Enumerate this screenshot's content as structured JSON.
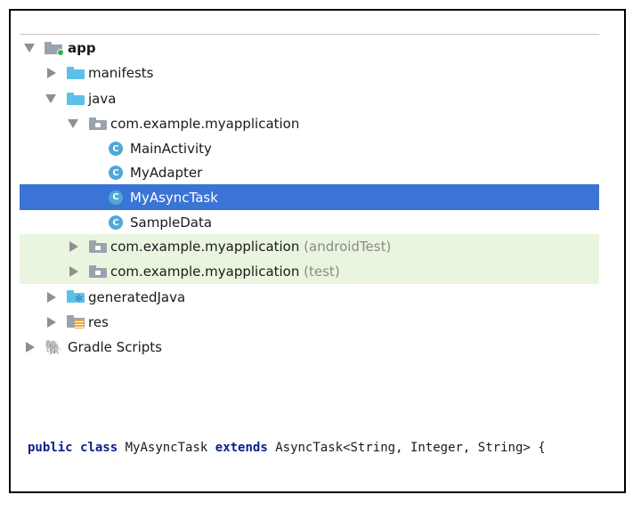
{
  "project_tree": {
    "root": {
      "label": "app"
    },
    "items": {
      "manifests": "manifests",
      "java": "java",
      "package_main": "com.example.myapplication",
      "classes": [
        "MainActivity",
        "MyAdapter",
        "MyAsyncTask",
        "SampleData"
      ],
      "package_android_test": "com.example.myapplication",
      "package_android_test_suffix": "(androidTest)",
      "package_test": "com.example.myapplication",
      "package_test_suffix": "(test)",
      "generated_java": "generatedJava",
      "res": "res",
      "gradle_scripts": "Gradle Scripts"
    },
    "selected": "MyAsyncTask"
  },
  "code": {
    "kw_public": "public",
    "kw_class": "class",
    "class_name": "MyAsyncTask",
    "kw_extends": "extends",
    "superclass": "AsyncTask<String, Integer, String> {"
  },
  "colors": {
    "selection": "#3a74d6",
    "test_package_bg": "#e9f5df",
    "folder_blue": "#5cc1e9",
    "class_icon": "#4ea9d8",
    "keyword": "#0a1f8a"
  }
}
